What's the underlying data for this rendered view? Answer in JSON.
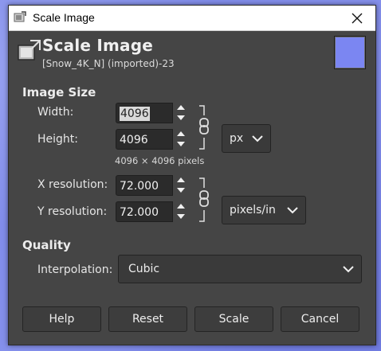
{
  "window": {
    "title": "Scale Image",
    "close_icon": "close-icon",
    "app_icon": "gimp-scale-icon"
  },
  "header": {
    "title": "Scale Image",
    "subtitle": "[Snow_4K_N] (imported)-23",
    "swatch_color": "#7b86f2"
  },
  "image_size": {
    "section_label": "Image Size",
    "width_label": "Width:",
    "width_value": "4096",
    "height_label": "Height:",
    "height_value": "4096",
    "size_info": "4096 × 4096 pixels",
    "unit_value": "px",
    "x_res_label": "X resolution:",
    "x_res_value": "72.000",
    "y_res_label": "Y resolution:",
    "y_res_value": "72.000",
    "res_unit_value": "pixels/in"
  },
  "quality": {
    "section_label": "Quality",
    "interpolation_label": "Interpolation:",
    "interpolation_value": "Cubic"
  },
  "buttons": {
    "help": "Help",
    "reset": "Reset",
    "scale": "Scale",
    "cancel": "Cancel"
  },
  "colors": {
    "dialog_bg": "#454545",
    "field_bg": "#2b2b2b",
    "button_bg": "#3d3d3d"
  }
}
